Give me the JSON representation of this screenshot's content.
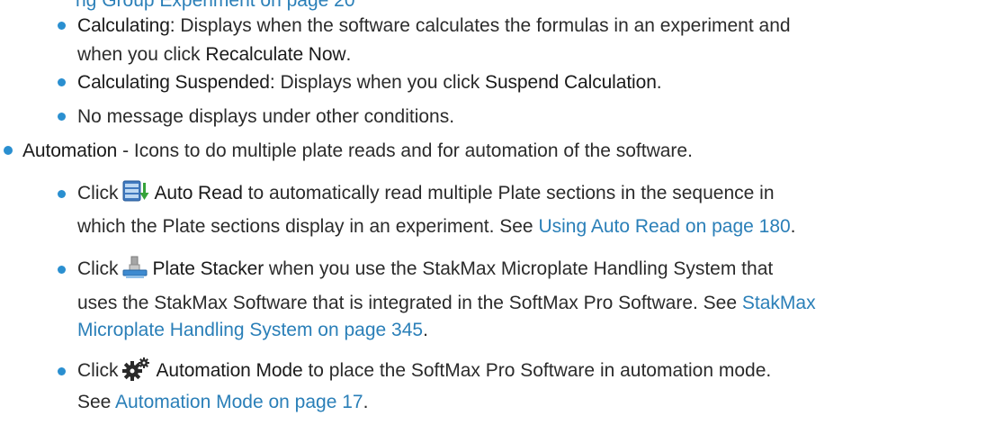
{
  "top_link": "ng Group Experiment on page 20",
  "calculating": {
    "label": "Calculating:",
    "text1": " Displays when the software calculates the formulas in an experiment and",
    "text2a": "when you click ",
    "button": "Recalculate Now",
    "text2b": "."
  },
  "suspended": {
    "label": "Calculating Suspended:",
    "text_a": " Displays when you click ",
    "button": "Suspend Calculation",
    "text_b": "."
  },
  "no_message": "No message displays under other conditions.",
  "automation": {
    "label": "Automation",
    "text": " - Icons to do multiple plate reads and for automation of the software."
  },
  "auto_read": {
    "click": "Click",
    "icon": "auto-read-icon",
    "label": "Auto Read",
    "text1": " to automatically read multiple Plate sections in the sequence in",
    "text2": "which the Plate sections display in an experiment. See ",
    "link": "Using Auto Read on page 180",
    "end": "."
  },
  "plate_stacker": {
    "click": "Click",
    "icon": "plate-stacker-icon",
    "label": "Plate Stacker",
    "text1": " when you use the StakMax Microplate Handling System that",
    "text2": "uses the StakMax Software that is integrated in the SoftMax Pro Software. See ",
    "link1": "StakMax",
    "link2": "Microplate Handling System on page 345",
    "end": "."
  },
  "automation_mode": {
    "click": "Click",
    "icon": "automation-mode-gears-icon",
    "label": "Automation Mode",
    "text1": " to place the SoftMax Pro Software in automation mode.",
    "text2": "See ",
    "link": "Automation Mode on page 17",
    "end": "."
  },
  "colors": {
    "bullet": "#2a8fd0",
    "link": "#2a7fb8",
    "text": "#2b2b2b"
  }
}
